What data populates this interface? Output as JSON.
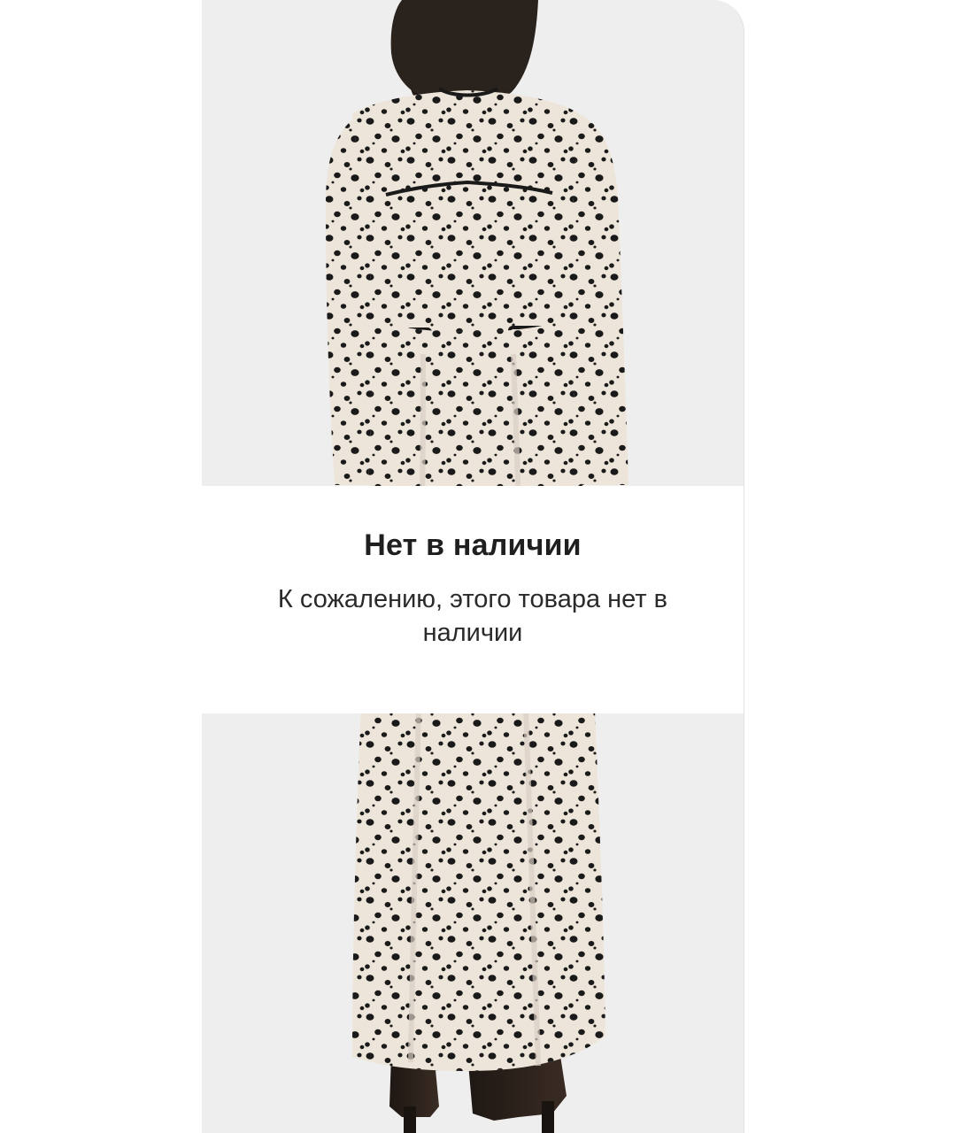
{
  "out_of_stock": {
    "title": "Нет в наличии",
    "message": "К сожалению, этого товара нет в наличии"
  },
  "product_image": {
    "subject": "dress-back-view-icon"
  },
  "colors": {
    "card_background": "#eeeeee",
    "dress_fabric": "#ede5da",
    "dress_dots": "#1a1a1a",
    "hair": "#2a221c",
    "overlay_background": "#ffffff",
    "title_text": "#1f1f1f"
  }
}
